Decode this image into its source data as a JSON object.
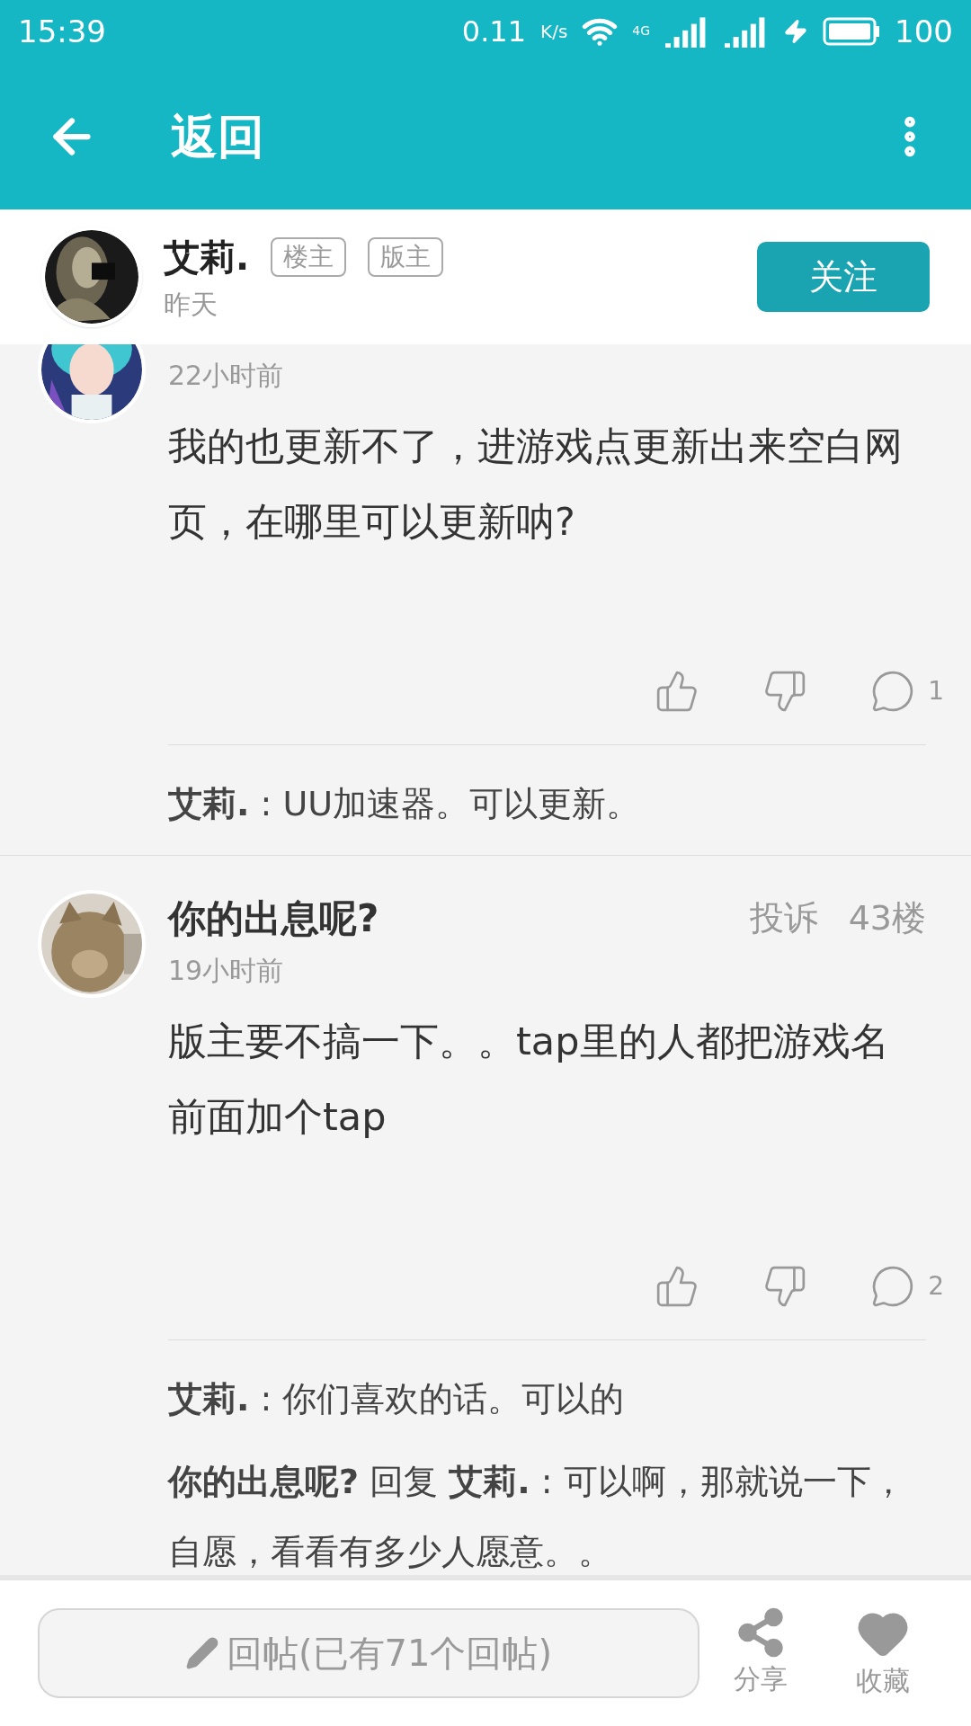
{
  "status_bar": {
    "time": "15:39",
    "speed": "0.11",
    "speed_unit": "K/s",
    "network": "4G",
    "battery": "100"
  },
  "app_bar": {
    "title": "返回"
  },
  "op": {
    "name": "艾莉.",
    "badges": [
      "楼主",
      "版主"
    ],
    "time": "昨天",
    "follow_button": "关注"
  },
  "comments": [
    {
      "time": "22小时前",
      "body": "我的也更新不了，进游戏点更新出来空白网页，在哪里可以更新呐?",
      "comment_count": "1",
      "replies": [
        "**艾莉.** : UU加速器。可以更新。"
      ]
    },
    {
      "name": "你的出息呢?",
      "report": "投诉",
      "floor": "43楼",
      "time": "19小时前",
      "body": "版主要不搞一下。。tap里的人都把游戏名前面加个tap",
      "comment_count": "2",
      "replies": [
        "**艾莉.** : 你们喜欢的话。可以的",
        "**你的出息呢?**  回复 **艾莉.** : 可以啊，那就说一下，自愿，看看有多少人愿意。。"
      ]
    }
  ],
  "footer": {
    "reply_placeholder": "回帖(已有71个回帖)",
    "actions": [
      "分享",
      "收藏"
    ]
  }
}
